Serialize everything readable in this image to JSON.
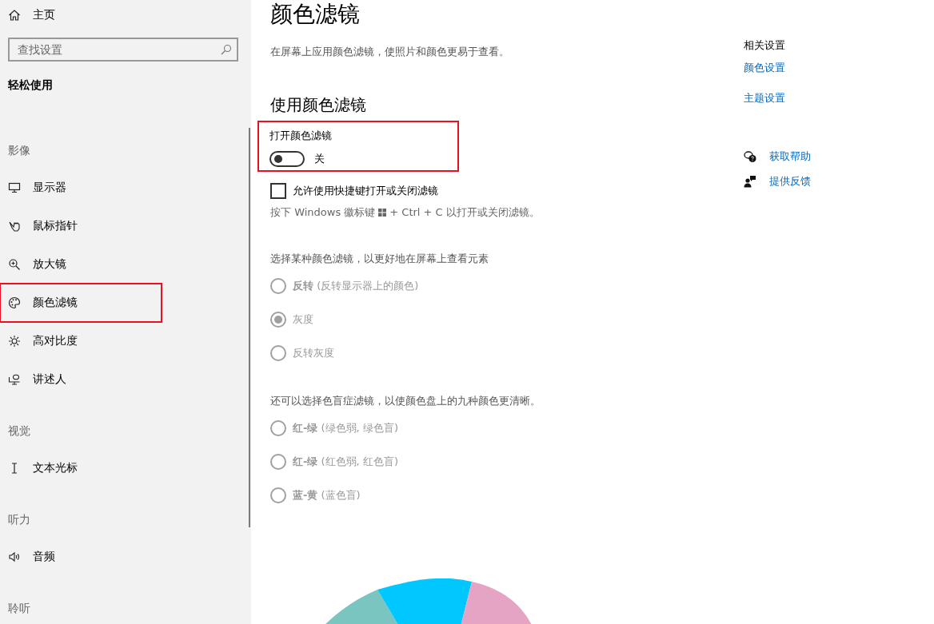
{
  "sidebar": {
    "home": {
      "label": "主页"
    },
    "search": {
      "placeholder": "查找设置"
    },
    "heading": "轻松使用",
    "sections": [
      {
        "title": "影像",
        "items": [
          {
            "label": "显示器",
            "highlighted": false
          },
          {
            "label": "鼠标指针",
            "highlighted": false
          },
          {
            "label": "放大镜",
            "highlighted": false
          },
          {
            "label": "颜色滤镜",
            "highlighted": true
          },
          {
            "label": "高对比度",
            "highlighted": false
          },
          {
            "label": "讲述人",
            "highlighted": false
          }
        ]
      },
      {
        "title": "视觉",
        "items": [
          {
            "label": "文本光标",
            "highlighted": false
          }
        ]
      },
      {
        "title": "听力",
        "items": [
          {
            "label": "音频",
            "highlighted": false
          }
        ]
      },
      {
        "title": "聆听"
      }
    ]
  },
  "main": {
    "title": "颜色滤镜",
    "description": "在屏幕上应用颜色滤镜，使照片和颜色更易于查看。",
    "section_title": "使用颜色滤镜",
    "toggle": {
      "label": "打开颜色滤镜",
      "on": false,
      "state_text": "关",
      "highlighted": true
    },
    "shortcut": {
      "label": "允许使用快捷键打开或关闭滤镜",
      "checked": false
    },
    "hint_before": "按下 Windows 徽标键",
    "hint_after": "+ Ctrl + C 以打开或关闭滤镜。",
    "filters_intro": "选择某种颜色滤镜，以更好地在屏幕上查看元素",
    "filters": [
      {
        "label": "**反转** (反转显示器上的颜色)",
        "selected": false,
        "disabled": true
      },
      {
        "label": "灰度",
        "selected": true,
        "disabled": true
      },
      {
        "label": "反转灰度",
        "selected": false,
        "disabled": true
      }
    ],
    "colorblind_intro": "还可以选择色盲症滤镜，以使颜色盘上的九种颜色更清晰。",
    "colorblind_filters": [
      {
        "label": "**红-绿** (绿色弱, 绿色盲)",
        "selected": false,
        "disabled": true
      },
      {
        "label": "**红-绿** (红色弱, 红色盲)",
        "selected": false,
        "disabled": true
      },
      {
        "label": "**蓝-黄** (蓝色盲)",
        "selected": false,
        "disabled": true
      }
    ]
  },
  "related": {
    "title": "相关设置",
    "links": [
      "颜色设置",
      "主题设置"
    ],
    "help": [
      {
        "label": "获取帮助"
      },
      {
        "label": "提供反馈"
      }
    ]
  }
}
